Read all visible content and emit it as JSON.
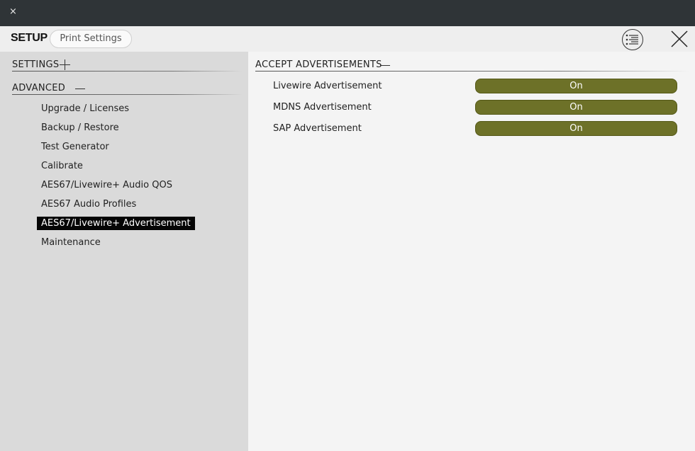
{
  "window": {
    "close_glyph": "×"
  },
  "header": {
    "title": "SETUP",
    "print_button": "Print Settings",
    "menu_icon": "list-menu-icon",
    "close_icon": "close-icon"
  },
  "sidebar": {
    "sections": [
      {
        "label": "SETTINGS",
        "state": "collapsed"
      },
      {
        "label": "ADVANCED",
        "state": "expanded"
      }
    ],
    "items": [
      {
        "label": "Upgrade / Licenses"
      },
      {
        "label": "Backup / Restore"
      },
      {
        "label": "Test Generator"
      },
      {
        "label": "Calibrate"
      },
      {
        "label": "AES67/Livewire+ Audio QOS"
      },
      {
        "label": "AES67 Audio Profiles"
      },
      {
        "label": "AES67/Livewire+ Advertisement",
        "active": true
      },
      {
        "label": "Maintenance"
      }
    ]
  },
  "main": {
    "section_title": "ACCEPT ADVERTISEMENTS",
    "rows": [
      {
        "label": "Livewire Advertisement",
        "value": "On"
      },
      {
        "label": "MDNS Advertisement",
        "value": "On"
      },
      {
        "label": "SAP Advertisement",
        "value": "On"
      }
    ]
  },
  "colors": {
    "titlebar": "#2f3437",
    "sidebar": "#dadada",
    "toggle_on": "#6d7128",
    "active_item": "#050505"
  }
}
